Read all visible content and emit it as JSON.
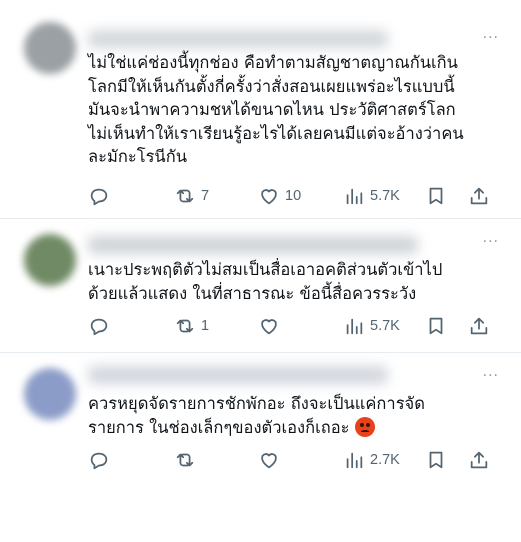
{
  "posts": [
    {
      "text": "ไม่ใช่แค่ช่องนี้ทุกช่อง คือทำตามสัญชาตญาณกันเกิน\nโลกมีให้เห็นกันตั้งกี่ครั้งว่าสั่งสอนเผยแพร่อะไรแบบนี้\nมันจะนำพาความชหได้ขนาดไหน ประวัติศาสตร์โลก\nไม่เห็นทำให้เราเรียนรู้อะไรได้เลยคนมีแต่จะอ้างว่าคน\nละมักะโรนีกัน",
      "has_emoji": false,
      "reply_count": "",
      "repost_count": "7",
      "like_count": "10",
      "view_count": "5.7K",
      "avatar_color": "#9aa0a4",
      "name_blur_color": "#c9ced2"
    },
    {
      "text": "เนาะประพฤติตัวไม่สมเป็นสื่อเอาอคติส่วนตัวเข้าไป\nด้วยแล้วแสดง ในที่สาธารณะ ข้อนี้สื่อควรระวัง",
      "has_emoji": false,
      "reply_count": "",
      "repost_count": "1",
      "like_count": "",
      "view_count": "5.7K",
      "avatar_color": "#6f8a64",
      "name_blur_color": "#c4c9cd"
    },
    {
      "text": "ควรหยุดจัดรายการชักพักอะ ถึงจะเป็นแค่การจัด\nรายการ ในช่องเล็กๆของตัวเองก็เถอะ ",
      "has_emoji": true,
      "reply_count": "",
      "repost_count": "",
      "like_count": "",
      "view_count": "2.7K",
      "avatar_color": "#8c9cc8",
      "name_blur_color": "#c8ccd6"
    }
  ],
  "more_label": "···",
  "icons": {
    "reply": "reply-icon",
    "repost": "repost-icon",
    "like": "heart-icon",
    "views": "views-bar-chart-icon",
    "bookmark": "bookmark-icon",
    "share": "share-icon",
    "emoji": "angry-face-emoji"
  },
  "colors": {
    "icon": "#536471",
    "text": "#0f1419",
    "emoji": "#e8421c"
  }
}
